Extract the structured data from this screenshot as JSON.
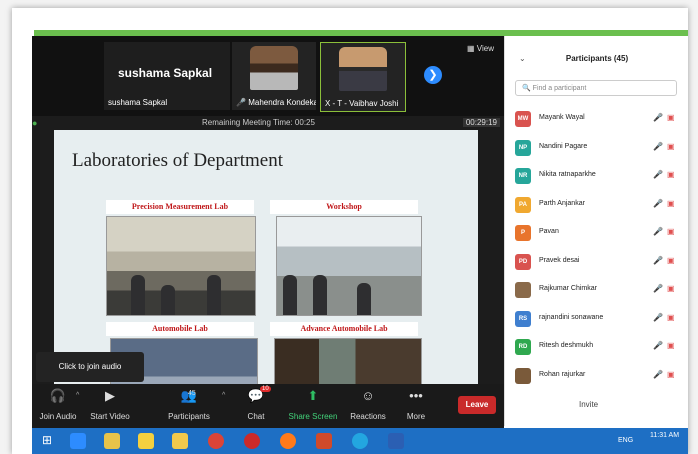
{
  "top_tiles": {
    "main_name": "sushama Sapkal",
    "main_label": "sushama Sapkal",
    "p2_label": "Mahendra Kondekar",
    "p3_label": "X - T - Vaibhav Joshi",
    "view_label": "View"
  },
  "meeting": {
    "remaining_text": "Remaining Meeting Time: 00:25",
    "elapsed": "00:29:19"
  },
  "slide": {
    "title": "Laboratories of Department",
    "captions": [
      "Precision Measurement Lab",
      "Workshop",
      "Automobile Lab",
      "Advance Automobile Lab"
    ]
  },
  "join_audio_popup": "Click to join audio",
  "toolbar": {
    "join_audio": "Join Audio",
    "start_video": "Start Video",
    "participants": "Participants",
    "participants_count": "45",
    "chat": "Chat",
    "chat_badge": "10",
    "share_screen": "Share Screen",
    "reactions": "Reactions",
    "more": "More",
    "leave": "Leave"
  },
  "participants_panel": {
    "title": "Participants (45)",
    "search_placeholder": "Find a participant",
    "invite": "Invite",
    "rows": [
      {
        "initials": "MW",
        "name": "Mayank Wayal",
        "color": "#d9534f"
      },
      {
        "initials": "NP",
        "name": "Nandini Pagare",
        "color": "#26a69a"
      },
      {
        "initials": "NR",
        "name": "Nikita ratnaparkhe",
        "color": "#26a69a"
      },
      {
        "initials": "PA",
        "name": "Parth Anjankar",
        "color": "#f0a830"
      },
      {
        "initials": "P",
        "name": "Pavan",
        "color": "#e8742c"
      },
      {
        "initials": "PD",
        "name": "Pravek desai",
        "color": "#d9534f"
      },
      {
        "initials": "",
        "name": "Rajkumar Chimkar",
        "color": "#8a6a4a"
      },
      {
        "initials": "RS",
        "name": "rajnandini sonawane",
        "color": "#3f7fcf"
      },
      {
        "initials": "RD",
        "name": "Ritesh deshmukh",
        "color": "#2fa84f"
      },
      {
        "initials": "",
        "name": "Rohan rajurkar",
        "color": "#7a5a3a"
      }
    ]
  },
  "taskbar": {
    "lang": "ENG",
    "time": "11:31 AM"
  }
}
